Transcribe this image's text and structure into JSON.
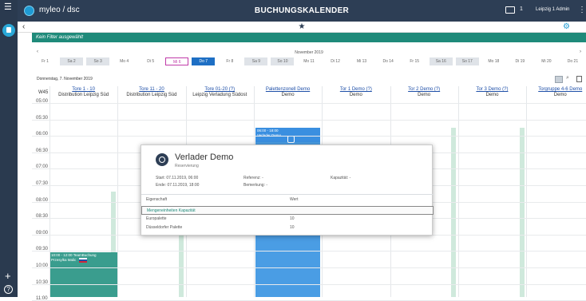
{
  "app": {
    "logo": "myleo / dsc",
    "title": "BUCHUNGSKALENDER",
    "notify_count": "1",
    "user": "Leipzig 1 Admin"
  },
  "filter": {
    "text": "Kein Filter ausgewählt"
  },
  "month": {
    "label": "November 2019"
  },
  "days": [
    "Fr 1",
    "Sa 2",
    "So 3",
    "Mo 4",
    "Di 5",
    "Mi 6",
    "Do 7",
    "Fr 8",
    "Sa 9",
    "So 10",
    "Mo 11",
    "Di 12",
    "Mi 13",
    "Do 14",
    "Fr 15",
    "Sa 16",
    "So 17",
    "Mo 18",
    "Di 19",
    "Mi 20",
    "Do 21"
  ],
  "weekend_days": [
    "Sa 2",
    "So 3",
    "Sa 9",
    "So 10",
    "Sa 16",
    "So 17"
  ],
  "selected_day": "Mi 6",
  "today_day": "Do 7",
  "date_label": "Donnerstag, 7. November 2019",
  "week": "W45",
  "columns": [
    {
      "link": "Tore 1 - 10",
      "sub": "Distribution Leipzig Süd"
    },
    {
      "link": "Tore 11 - 20",
      "sub": "Distribution Leipzig Süd"
    },
    {
      "link": "Tore 01-20 (?)",
      "sub": "Leipzig Verladung Südost"
    },
    {
      "link": "Palettenzonell Demo",
      "sub": "Demo"
    },
    {
      "link": "Tor 1 Demo (?)",
      "sub": "Demo"
    },
    {
      "link": "Tor 2 Demo (?)",
      "sub": "Demo"
    },
    {
      "link": "Tor 3 Demo (?)",
      "sub": "Demo"
    },
    {
      "link": "Torgruppe 4-6 Demo",
      "sub": "Demo"
    }
  ],
  "times": [
    "05:00",
    "05:30",
    "06:00",
    "06:30",
    "07:00",
    "07:30",
    "08:00",
    "08:30",
    "09:00",
    "09:30",
    "10:00",
    "10:30",
    "11:00"
  ],
  "events": {
    "verlader": "06:00 - 18:00\nVerlader Demo",
    "team": "10:00 - 12:00 TeamBuchung\nPrzesylka Malic"
  },
  "popup": {
    "title": "Verlader Demo",
    "subtitle": "Reservierung",
    "start": "Start: 07.11.2019, 06:00",
    "end": "Ende: 07.11.2019, 18:00",
    "referenz": "Referenz: -",
    "bemerkung": "Bemerkung: -",
    "kapazitaet": "Kapazität: -",
    "col_prop": "Eigenschaft",
    "col_val": "Wert",
    "rows": [
      {
        "prop": "Mengeneinheiten Kapazität",
        "val": ""
      },
      {
        "prop": "Europalette",
        "val": "10"
      },
      {
        "prop": "Düsseldorfer Palette",
        "val": "10"
      }
    ]
  },
  "colors": {
    "topbar": "#2d3e55",
    "teal": "#1f8a7a",
    "event_blue": "#4a9de4",
    "selected": "#c03aa8"
  }
}
